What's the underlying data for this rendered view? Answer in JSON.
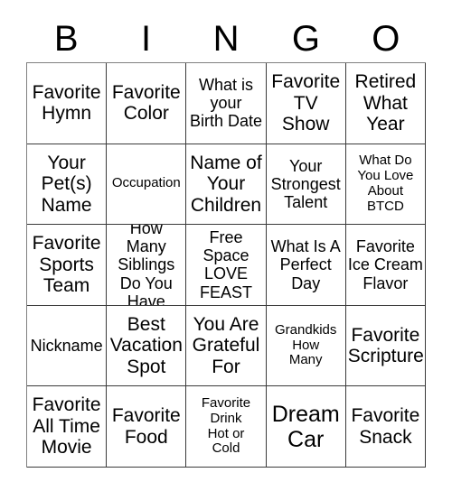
{
  "card": {
    "header_letters": [
      "B",
      "I",
      "N",
      "G",
      "O"
    ],
    "columns": 5,
    "rows": 5,
    "border_color": "#3a3a3a",
    "text_color": "#000000",
    "background_color": "#ffffff",
    "cells": [
      {
        "text": "Favorite\nHymn",
        "size": "lg",
        "row": 1,
        "col": 1
      },
      {
        "text": "Favorite\nColor",
        "size": "lg",
        "row": 1,
        "col": 2
      },
      {
        "text": "What is\nyour\nBirth Date",
        "size": "md",
        "row": 1,
        "col": 3
      },
      {
        "text": "Favorite\nTV\nShow",
        "size": "lg",
        "row": 1,
        "col": 4
      },
      {
        "text": "Retired\nWhat\nYear",
        "size": "lg",
        "row": 1,
        "col": 5
      },
      {
        "text": "Your\nPet(s)\nName",
        "size": "lg",
        "row": 2,
        "col": 1
      },
      {
        "text": "Occupation",
        "size": "sm",
        "row": 2,
        "col": 2
      },
      {
        "text": "Name of\nYour\nChildren",
        "size": "lg",
        "row": 2,
        "col": 3
      },
      {
        "text": "Your\nStrongest\nTalent",
        "size": "md",
        "row": 2,
        "col": 4
      },
      {
        "text": "What Do\nYou Love\nAbout\nBTCD",
        "size": "sm",
        "row": 2,
        "col": 5
      },
      {
        "text": "Favorite\nSports\nTeam",
        "size": "lg",
        "row": 3,
        "col": 1
      },
      {
        "text": "How Many\nSiblings\nDo You\nHave",
        "size": "md",
        "row": 3,
        "col": 2
      },
      {
        "text": "Free\nSpace\nLOVE\nFEAST",
        "size": "md",
        "row": 3,
        "col": 3
      },
      {
        "text": "What Is A\nPerfect\nDay",
        "size": "md",
        "row": 3,
        "col": 4
      },
      {
        "text": "Favorite\nIce Cream\nFlavor",
        "size": "md",
        "row": 3,
        "col": 5
      },
      {
        "text": "Nickname",
        "size": "md",
        "row": 4,
        "col": 1
      },
      {
        "text": "Best\nVacation\nSpot",
        "size": "lg",
        "row": 4,
        "col": 2
      },
      {
        "text": "You Are\nGrateful\nFor",
        "size": "lg",
        "row": 4,
        "col": 3
      },
      {
        "text": "Grandkids\nHow\nMany",
        "size": "sm",
        "row": 4,
        "col": 4
      },
      {
        "text": "Favorite\nScripture",
        "size": "lg",
        "row": 4,
        "col": 5
      },
      {
        "text": "Favorite\nAll Time\nMovie",
        "size": "lg",
        "row": 5,
        "col": 1
      },
      {
        "text": "Favorite\nFood",
        "size": "lg",
        "row": 5,
        "col": 2
      },
      {
        "text": "Favorite\nDrink\nHot or\nCold",
        "size": "sm",
        "row": 5,
        "col": 3
      },
      {
        "text": "Dream\nCar",
        "size": "xl",
        "row": 5,
        "col": 4
      },
      {
        "text": "Favorite\nSnack",
        "size": "lg",
        "row": 5,
        "col": 5
      }
    ]
  }
}
